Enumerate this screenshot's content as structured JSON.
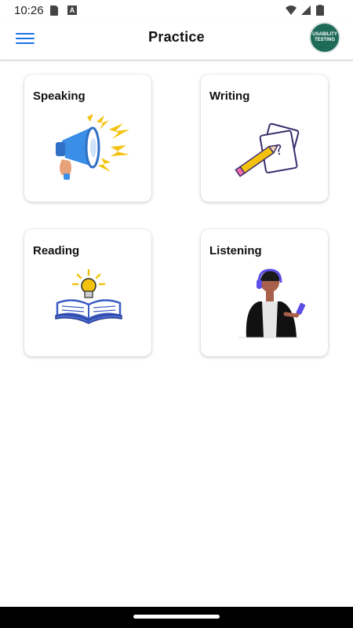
{
  "status_bar": {
    "time": "10:26",
    "icons": [
      "sd-card-icon",
      "accessibility-a-icon",
      "wifi-icon",
      "signal-icon",
      "battery-icon"
    ]
  },
  "app_bar": {
    "title": "Practice",
    "menu_icon": "hamburger-menu-icon",
    "avatar": {
      "line1": "USABILITY",
      "line2": "TESTING"
    }
  },
  "cards": [
    {
      "label": "Speaking",
      "icon": "megaphone-illustration"
    },
    {
      "label": "Writing",
      "icon": "pencil-paper-illustration"
    },
    {
      "label": "Reading",
      "icon": "open-book-lightbulb-illustration"
    },
    {
      "label": "Listening",
      "icon": "person-headphones-illustration"
    }
  ],
  "colors": {
    "accent": "#1a73e8",
    "avatar_bg": "#1f6b5a",
    "illustration_purple": "#5b4de6",
    "illustration_yellow": "#f4c20d"
  }
}
